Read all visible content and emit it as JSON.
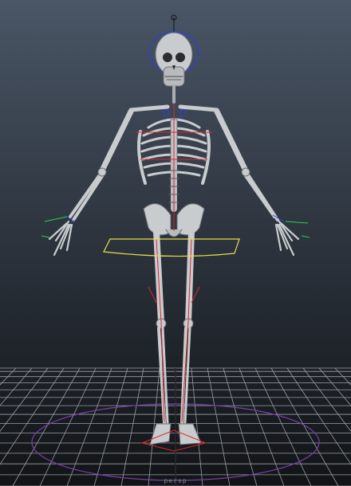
{
  "viewport": {
    "camera_label": "persp",
    "colors": {
      "grid": "#9aa0a6",
      "grid_center": "#2a2a2a",
      "bone": "#c9ccce",
      "bone_shadow": "#7e8387",
      "rig_red": "#e0262a",
      "rig_blue": "#2c40d8",
      "rig_green": "#2bd24a",
      "rig_yellow": "#e6e04a",
      "rig_purple": "#7a3fb0"
    },
    "objects": [
      "skeleton",
      "skull-control",
      "hip-control",
      "ik-handles",
      "ground-grid"
    ]
  }
}
